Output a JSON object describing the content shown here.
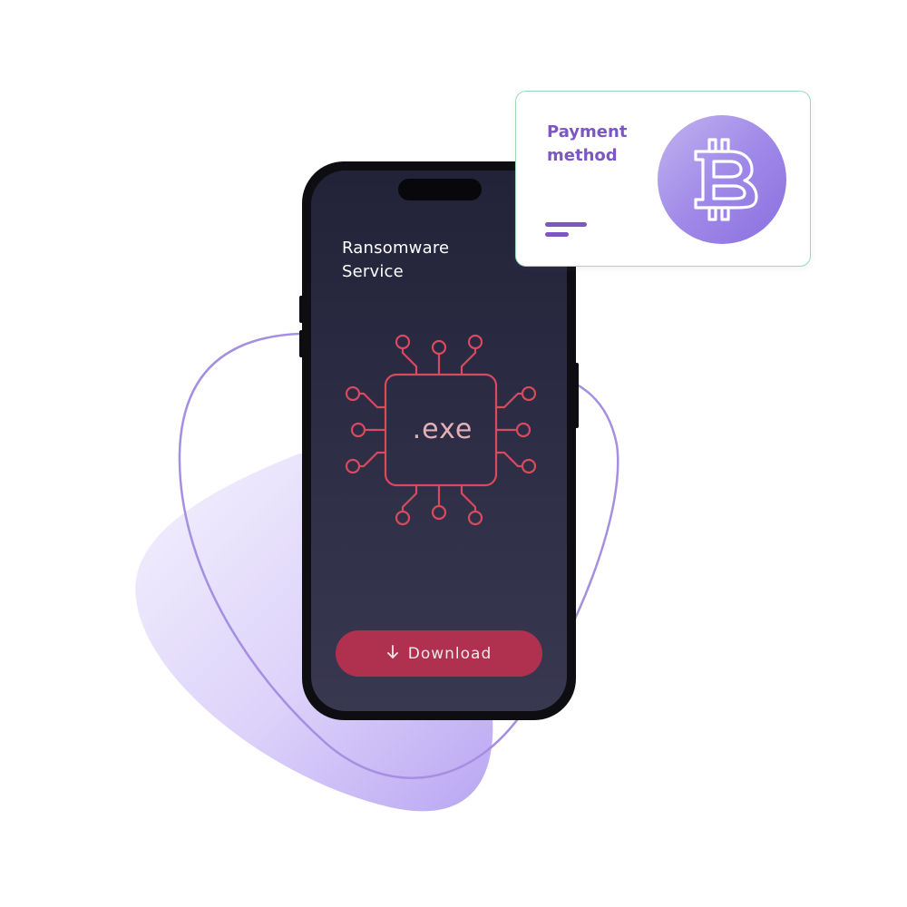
{
  "phone": {
    "title_line1": "Ransomware",
    "title_line2": "Service",
    "chip_label": ".exe",
    "download_label": "Download",
    "download_icon": "download-arrow-icon"
  },
  "payment_card": {
    "title_line1": "Payment",
    "title_line2": "method",
    "currency_icon": "bitcoin-icon",
    "menu_icon": "menu-lines-icon"
  },
  "colors": {
    "accent_purple": "#7c56c2",
    "download_button": "#b0314f",
    "chip_stroke": "#d84a5e",
    "card_border": "#9fd8bc",
    "blob_fill": "#c4b5f3",
    "outline_stroke": "#a48fe0"
  }
}
